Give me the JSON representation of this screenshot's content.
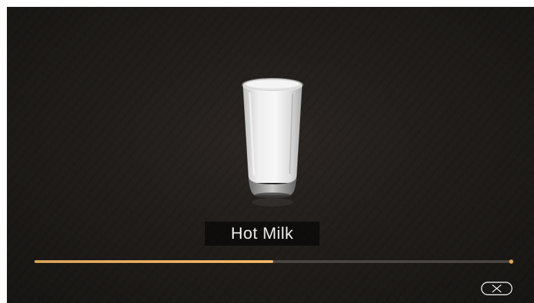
{
  "product": {
    "name": "Hot Milk",
    "image_icon": "milk-glass-icon"
  },
  "brewing": {
    "progress": 0.5,
    "progress_color": "#f2b866",
    "track_color": "#4a4540"
  },
  "controls": {
    "cancel_icon": "close-icon"
  }
}
